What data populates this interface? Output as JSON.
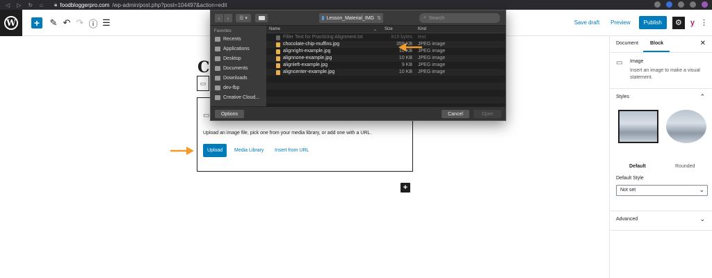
{
  "browser": {
    "url_host": "foodbloggerpro.com",
    "url_path": "/wp-admin/post.php?post=104497&action=edit"
  },
  "toolbar": {
    "add_block": "+",
    "save_draft": "Save draft",
    "preview": "Preview",
    "publish": "Publish"
  },
  "editor": {
    "title_partial": "Cl",
    "image_block": {
      "instructions": "Upload an image file, pick one from your media library, or add one with a URL.",
      "upload": "Upload",
      "media_library": "Media Library",
      "insert_from_url": "Insert from URL"
    },
    "add_block_symbol": "+"
  },
  "sidebar": {
    "tabs": [
      "Document",
      "Block"
    ],
    "active_tab": "Block",
    "close": "✕",
    "block": {
      "name": "Image",
      "description": "Insert an image to make a visual statement."
    },
    "styles": {
      "title": "Styles",
      "options": [
        "Default",
        "Rounded"
      ],
      "selected": "Default",
      "default_style_label": "Default Style",
      "default_style_value": "Not set"
    },
    "advanced": "Advanced"
  },
  "dialog": {
    "path": "Lesson_Material_IMG",
    "search_placeholder": "Search",
    "favorites_label": "Favorites",
    "favorites": [
      "Recents",
      "Applications",
      "Desktop",
      "Documents",
      "Downloads",
      "dev-fbp",
      "Creative Cloud..."
    ],
    "columns": {
      "name": "Name",
      "size": "Size",
      "kind": "Kind"
    },
    "files": [
      {
        "name": "Filler Text for Practicing Alignment.txt",
        "size": "819 bytes",
        "kind": "text",
        "dimmed": true
      },
      {
        "name": "chocolate-chip-muffins.jpg",
        "size": "359 KB",
        "kind": "JPEG image",
        "dimmed": false
      },
      {
        "name": "alignright-example.jpg",
        "size": "10 KB",
        "kind": "JPEG image",
        "dimmed": false
      },
      {
        "name": "alignnone-example.jpg",
        "size": "10 KB",
        "kind": "JPEG image",
        "dimmed": false
      },
      {
        "name": "alignleft-example.jpg",
        "size": "9 KB",
        "kind": "JPEG image",
        "dimmed": false
      },
      {
        "name": "aligncenter-example.jpg",
        "size": "10 KB",
        "kind": "JPEG image",
        "dimmed": false
      }
    ],
    "options": "Options",
    "cancel": "Cancel",
    "open": "Open"
  },
  "colors": {
    "wp_blue": "#007cba",
    "annotation_orange": "#f39a2b",
    "dialog_bg": "#2b2b2b"
  }
}
